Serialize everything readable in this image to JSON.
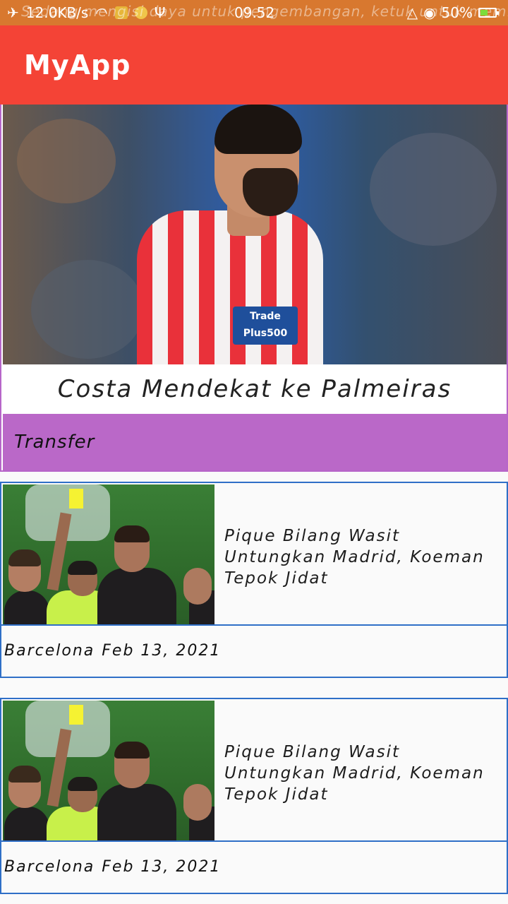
{
  "status_bar": {
    "left_text": "12.0KB/s",
    "ticker_text": "Sedang mengisi daya untuk pengembangan, ketuk untuk mem...",
    "time": "09.52",
    "battery_percent": "50%",
    "battery_level": 0.5,
    "icons": [
      "airplane-icon",
      "wifi-icon",
      "notification-icon",
      "usb-icon",
      "alarm-icon",
      "eye-icon",
      "battery-icon"
    ]
  },
  "appbar": {
    "title": "MyApp"
  },
  "featured": {
    "headline": "Costa Mendekat ke Palmeiras",
    "category": "Transfer",
    "image_sponsor_text": "Trade Plus500"
  },
  "news": [
    {
      "title": "Pique Bilang Wasit Untungkan Madrid, Koeman Tepok Jidat",
      "team": "Barcelona",
      "date": "Feb 13, 2021"
    },
    {
      "title": "Pique Bilang Wasit Untungkan Madrid, Koeman Tepok Jidat",
      "team": "Barcelona",
      "date": "Feb 13, 2021"
    }
  ],
  "colors": {
    "status_bar": "#d8782f",
    "appbar": "#f44336",
    "category_bar": "#ba68c8",
    "card_border": "#2f6fc7"
  }
}
